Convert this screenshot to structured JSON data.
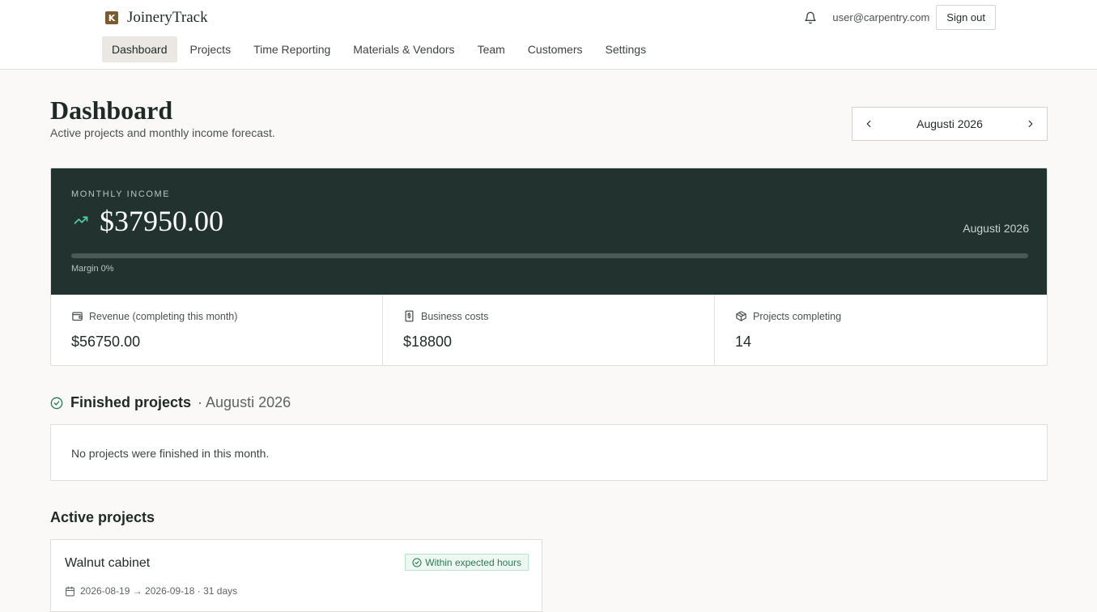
{
  "app": {
    "name": "JoineryTrack",
    "logo_letter": "K"
  },
  "header": {
    "user_email": "user@carpentry.com",
    "sign_out_label": "Sign out"
  },
  "nav": [
    {
      "label": "Dashboard",
      "active": true
    },
    {
      "label": "Projects"
    },
    {
      "label": "Time Reporting"
    },
    {
      "label": "Materials & Vendors"
    },
    {
      "label": "Team"
    },
    {
      "label": "Customers"
    },
    {
      "label": "Settings"
    }
  ],
  "page": {
    "title": "Dashboard",
    "subtitle": "Active projects and monthly income forecast."
  },
  "month_picker": {
    "label": "Augusti 2026"
  },
  "income": {
    "caption": "MONTHLY INCOME",
    "amount": "$37950.00",
    "month": "Augusti 2026",
    "margin_label": "Margin 0%",
    "margin_fraction": 0
  },
  "stats": [
    {
      "label": "Revenue (completing this month)",
      "value": "$56750.00",
      "icon": "wallet-icon"
    },
    {
      "label": "Business costs",
      "value": "$18800",
      "icon": "receipt-icon"
    },
    {
      "label": "Projects completing",
      "value": "14",
      "icon": "package-icon"
    }
  ],
  "finished": {
    "title": "Finished projects",
    "month": "· Augusti 2026",
    "empty_text": "No projects were finished in this month."
  },
  "active": {
    "title": "Active projects",
    "projects": [
      {
        "name": "Walnut cabinet",
        "badge": "Within expected hours",
        "dates": "2026-08-19 → 2026-09-18 · 31 days"
      }
    ]
  },
  "colors": {
    "accent_dark": "#22332f",
    "success": "#2a7a57",
    "trend": "#4fd1a0"
  }
}
